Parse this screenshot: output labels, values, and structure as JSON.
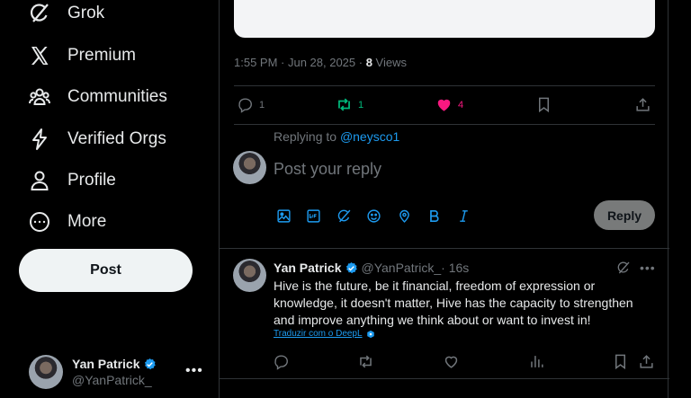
{
  "sidebar": {
    "nav": [
      {
        "label": "Grok",
        "icon": "grok-icon"
      },
      {
        "label": "Premium",
        "icon": "x-logo-icon"
      },
      {
        "label": "Communities",
        "icon": "communities-icon"
      },
      {
        "label": "Verified Orgs",
        "icon": "lightning-icon"
      },
      {
        "label": "Profile",
        "icon": "person-icon"
      },
      {
        "label": "More",
        "icon": "more-circle-icon"
      }
    ],
    "post_label": "Post",
    "account": {
      "name": "Yan Patrick",
      "handle": "@YanPatrick_",
      "more": "•••"
    }
  },
  "tweet_detail": {
    "time": "1:55 PM · Jun 28, 2025 · ",
    "views_count": "8",
    "views_label": " Views",
    "actions": {
      "replies": "1",
      "reposts": "1",
      "likes": "4"
    }
  },
  "reply_composer": {
    "replying_to_label": "Replying to ",
    "replying_to_handle": "@neysco1",
    "placeholder": "Post your reply",
    "button_label": "Reply"
  },
  "reply_tweet": {
    "name": "Yan Patrick",
    "handle": "@YanPatrick_",
    "time": " · 16s",
    "text": "Hive is the future, be it financial, freedom of expression or knowledge, it doesn't matter, Hive has the capacity to strengthen and improve anything we think about or want to invest in!",
    "translate_label": "Traduzir com o DeepL",
    "more": "•••"
  },
  "colors": {
    "accent": "#1d9bf0",
    "repost": "#00ba7c",
    "like": "#f91880",
    "muted": "#71767b"
  }
}
